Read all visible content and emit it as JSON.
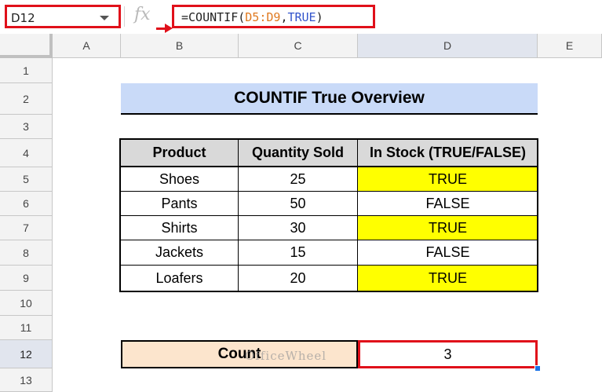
{
  "name_box": "D12",
  "formula": {
    "prefix": "=COUNTIF(",
    "range": "D5:D9",
    "comma": ",",
    "criterion": "TRUE",
    "suffix": ")"
  },
  "columns": [
    "A",
    "B",
    "C",
    "D",
    "E"
  ],
  "rows": [
    "1",
    "2",
    "3",
    "4",
    "5",
    "6",
    "7",
    "8",
    "9",
    "10",
    "11",
    "12",
    "13"
  ],
  "title": "COUNTIF True Overview",
  "table": {
    "headers": [
      "Product",
      "Quantity Sold",
      "In Stock (TRUE/FALSE)"
    ],
    "rows": [
      [
        "Shoes",
        "25",
        "TRUE"
      ],
      [
        "Pants",
        "50",
        "FALSE"
      ],
      [
        "Shirts",
        "30",
        "TRUE"
      ],
      [
        "Jackets",
        "15",
        "FALSE"
      ],
      [
        "Loafers",
        "20",
        "TRUE"
      ]
    ]
  },
  "count": {
    "label": "Count",
    "value": "3"
  },
  "watermark": "OfficeWheel",
  "colors": {
    "highlight": "#ffff00",
    "accent_red": "#e0101a",
    "title_bg": "#c9daf8",
    "count_bg": "#fce5cd"
  }
}
